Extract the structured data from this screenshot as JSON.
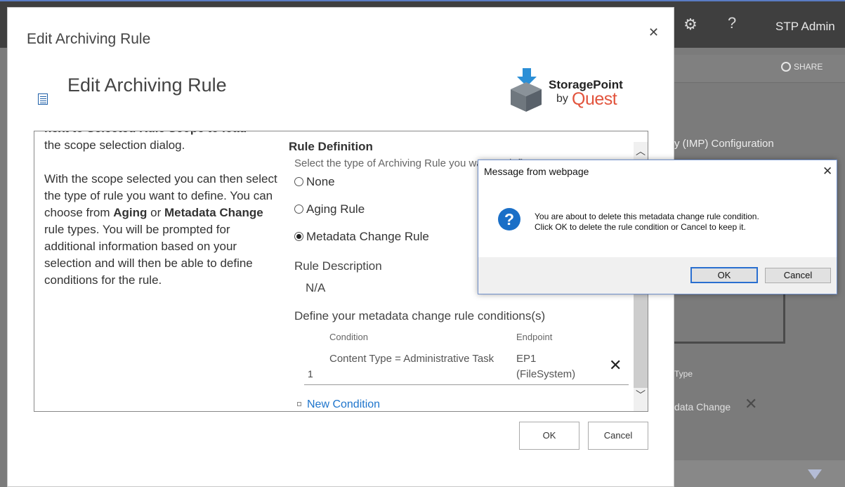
{
  "background": {
    "user": "STP Admin",
    "share": "SHARE",
    "imp_config": "y (IMP) Configuration",
    "type_label": "Type",
    "metadata_change": "data Change"
  },
  "dialog": {
    "title": "Edit Archiving Rule",
    "heading": "Edit Archiving Rule",
    "logo": {
      "name": "StoragePoint",
      "by": "by",
      "quest": "Quest"
    },
    "help": {
      "cut_line": "next to Selected Rule Scope to load",
      "p1": "the scope selection dialog.",
      "p2_a": "With the scope selected you can then select the type of rule you want to define. You can choose from ",
      "p2_aging": "Aging",
      "p2_or": " or ",
      "p2_meta": "Metadata Change",
      "p2_b": " rule types. You will be prompted for additional information based on your selection and will then be able to define conditions for the rule."
    },
    "rule_definition": "Rule Definition",
    "select_prompt": "Select the type of Archiving Rule you want to define",
    "radios": [
      "None",
      "Aging Rule",
      "Metadata Change Rule"
    ],
    "selected_radio": "Metadata Change Rule",
    "rule_description_label": "Rule Description",
    "rule_description_value": "N/A",
    "define_label": "Define your metadata change rule conditions(s)",
    "columns": {
      "condition": "Condition",
      "endpoint": "Endpoint"
    },
    "rows": [
      {
        "num": "1",
        "condition": "Content Type = Administrative Task",
        "endpoint": "EP1 (FileSystem)"
      }
    ],
    "new_condition": "New Condition",
    "ok": "OK",
    "cancel": "Cancel"
  },
  "message_box": {
    "title": "Message from webpage",
    "text_line1": "You are about to delete this metadata change rule condition.",
    "text_line2": "Click OK to delete the rule condition or Cancel to keep it.",
    "ok": "OK",
    "cancel": "Cancel"
  }
}
